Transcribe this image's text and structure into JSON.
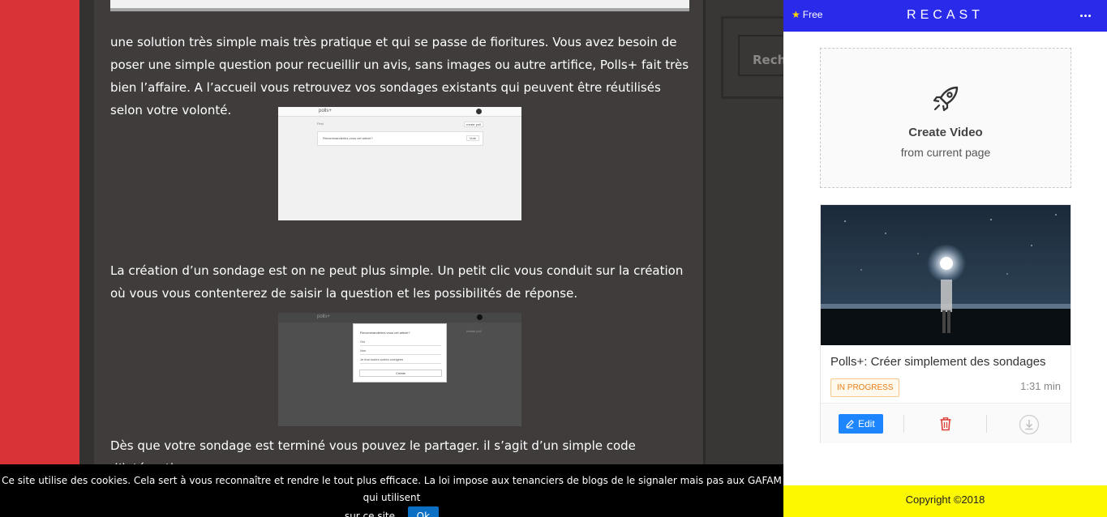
{
  "article": {
    "p1": "une solution très simple mais très pratique et qui se passe de fioritures. Vous avez besoin de poser une simple question pour recueillir un avis, sans images ou autre artifice, Polls+ fait très bien l’affaire. A l’accueil vous retrouvez vos sondages existants qui peuvent être réutilisés selon votre volonté.",
    "p2": "La création d’un sondage est on ne peut plus simple. Un petit clic vous conduit sur la création où vous vous contenterez de saisir la question et les possibilités de réponse.",
    "p3": "Dès que votre sondage est terminé vous pouvez le partager. il s’agit d’un simple code d’intégration que"
  },
  "screenshot1": {
    "logo": "polls+",
    "filter": "Find",
    "create": "create poll",
    "question": "Recommanderiez-vous cet article?",
    "vote": "Vote"
  },
  "screenshot2": {
    "logo": "polls+",
    "question": "Recommanderiez-vous cet article?",
    "options": [
      "Oui",
      "Non",
      "Je lirai toutes sortes corrigées"
    ],
    "create": "Create",
    "side": "create poll"
  },
  "sidebar": {
    "search_placeholder": "Rechercher"
  },
  "cookie": {
    "message_line1": "Ce site utilise des cookies. Cela sert à vous reconnaître et rendre le tout plus efficace. La loi impose aux tenanciers de blogs de le signaler mais pas aux GAFAM qui utilisent",
    "message_line2": "sur ce site.",
    "ok_label": "Ok"
  },
  "recast": {
    "plan": "Free",
    "brand": "RECAST",
    "create_title": "Create Video",
    "create_subtitle": "from current page",
    "video": {
      "title": "Polls+: Créer simplement des sondages",
      "status": "IN PROGRESS",
      "duration": "1:31 min",
      "edit_label": "Edit"
    },
    "footer": "Copyright ©2018"
  },
  "colors": {
    "header_blue": "#2a2aeb",
    "red_strip": "#d93237",
    "footer_yellow": "#fbf800",
    "edit_blue": "#1d86ff",
    "badge_orange": "#e6801a",
    "trash_red": "#e0403a"
  }
}
